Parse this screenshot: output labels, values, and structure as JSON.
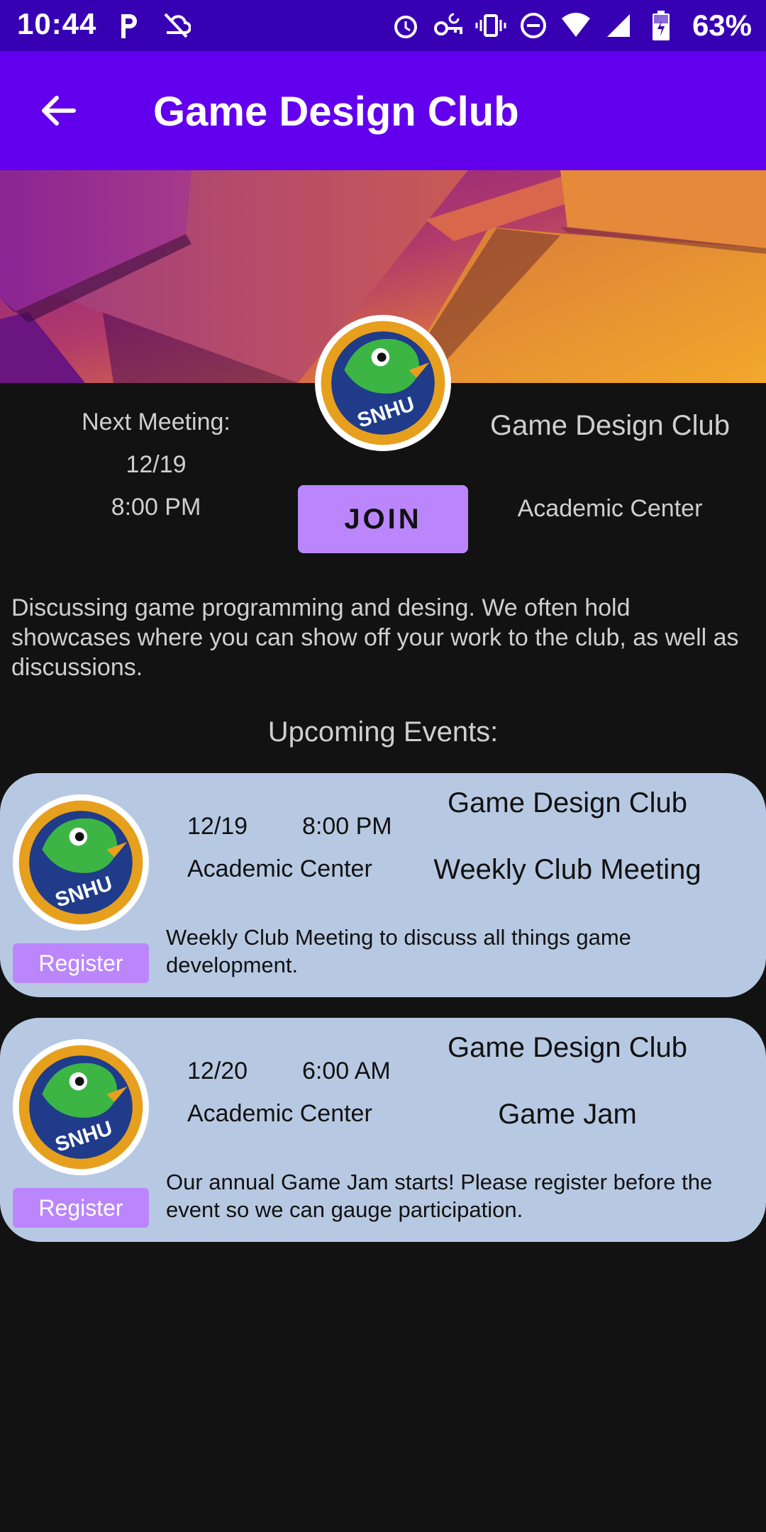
{
  "status_bar": {
    "time": "10:44",
    "battery": "63%",
    "icons_left": [
      "parking-icon",
      "sync-off-icon"
    ],
    "icons_right": [
      "alarm-icon",
      "vpn-key-icon",
      "vibrate-icon",
      "dnd-icon",
      "wifi-icon",
      "signal-icon",
      "battery-charging-icon"
    ]
  },
  "app_bar": {
    "title": "Game Design Club",
    "back_icon": "arrow-back-icon"
  },
  "club": {
    "next_meeting_label": "Next Meeting:",
    "next_meeting_date": "12/19",
    "next_meeting_time": "8:00 PM",
    "name": "Game Design Club",
    "location": "Academic Center",
    "join_label": "JOIN",
    "logo_text": "SNHU",
    "description": "Discussing game programming and desing. We often hold showcases where you can show off your work to the club, as well as discussions."
  },
  "upcoming_label": "Upcoming Events:",
  "events": [
    {
      "date": "12/19",
      "time": "8:00 PM",
      "location": "Academic Center",
      "club": "Game Design Club",
      "title": "Weekly Club Meeting",
      "description": "Weekly Club Meeting to discuss all things game development.",
      "register_label": "Register"
    },
    {
      "date": "12/20",
      "time": "6:00 AM",
      "location": "Academic Center",
      "club": "Game Design Club",
      "title": "Game Jam",
      "description": "Our annual Game Jam starts! Please register before the event so we can gauge participation.",
      "register_label": "Register"
    }
  ],
  "colors": {
    "status_bar": "#3700b3",
    "app_bar": "#6200ee",
    "accent": "#bb86fc",
    "card": "#b7c9e2",
    "background": "#121212"
  }
}
